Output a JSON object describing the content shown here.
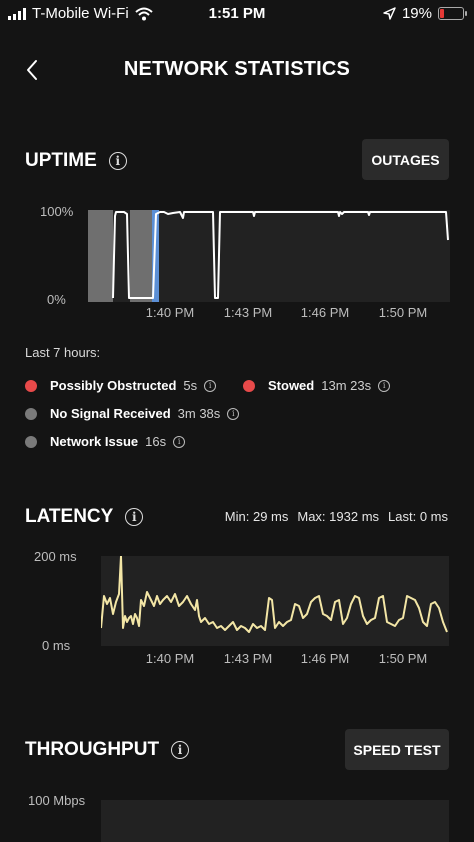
{
  "status_bar": {
    "carrier": "T-Mobile Wi-Fi",
    "time": "1:51 PM",
    "battery": "19%",
    "battery_color": "#e53935"
  },
  "header": {
    "title": "NETWORK STATISTICS"
  },
  "uptime": {
    "title": "UPTIME",
    "button": "OUTAGES",
    "y_top": "100%",
    "y_bottom": "0%",
    "x_ticks": [
      "1:40 PM",
      "1:43 PM",
      "1:46 PM",
      "1:50 PM"
    ],
    "legend_caption": "Last 7 hours:",
    "legend": [
      {
        "name": "Possibly Obstructed",
        "value": "5s",
        "color": "#e84a4a"
      },
      {
        "name": "Stowed",
        "value": "13m 23s",
        "color": "#e84a4a"
      },
      {
        "name": "No Signal Received",
        "value": "3m 38s",
        "color": "#7a7a7a"
      },
      {
        "name": "Network Issue",
        "value": "16s",
        "color": "#7a7a7a"
      }
    ]
  },
  "latency": {
    "title": "LATENCY",
    "min": "Min: 29 ms",
    "max": "Max: 1932 ms",
    "last": "Last: 0 ms",
    "y_top": "200 ms",
    "y_bottom": "0 ms",
    "x_ticks": [
      "1:40 PM",
      "1:43 PM",
      "1:46 PM",
      "1:50 PM"
    ],
    "line_color": "#f3e6a6"
  },
  "throughput": {
    "title": "THROUGHPUT",
    "button": "SPEED TEST",
    "y_top": "100 Mbps"
  }
}
